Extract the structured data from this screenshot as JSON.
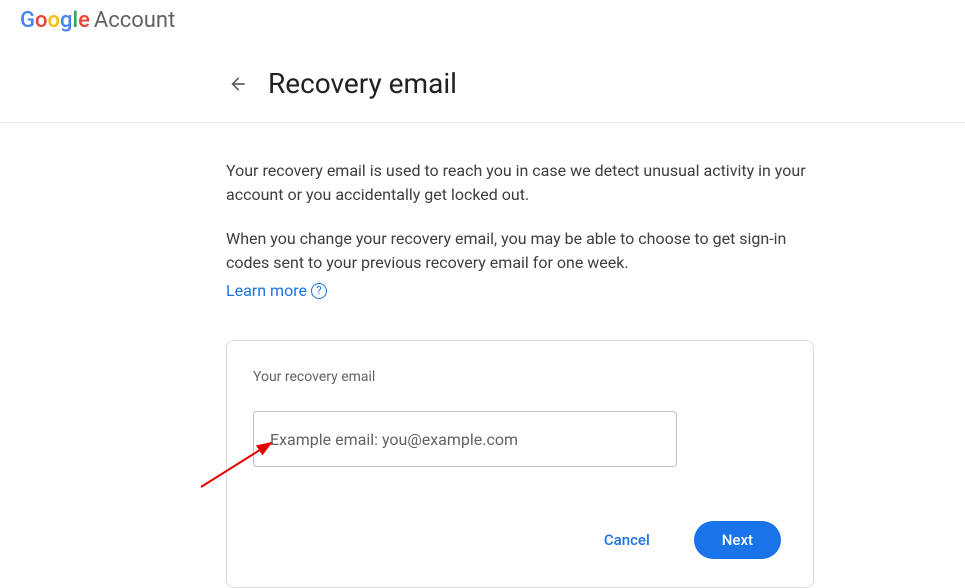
{
  "header": {
    "brand_g1": "G",
    "brand_o1": "o",
    "brand_o2": "o",
    "brand_g2": "g",
    "brand_l1": "l",
    "brand_e1": "e",
    "brand_account": "Account"
  },
  "page": {
    "title": "Recovery email",
    "description1": "Your recovery email is used to reach you in case we detect unusual activity in your account or you accidentally get locked out.",
    "description2": "When you change your recovery email, you may be able to choose to get sign-in codes sent to your previous recovery email for one week.",
    "learn_more": "Learn more",
    "help_icon": "?"
  },
  "card": {
    "label": "Your recovery email",
    "placeholder": "Example email: you@example.com",
    "cancel_label": "Cancel",
    "next_label": "Next"
  }
}
